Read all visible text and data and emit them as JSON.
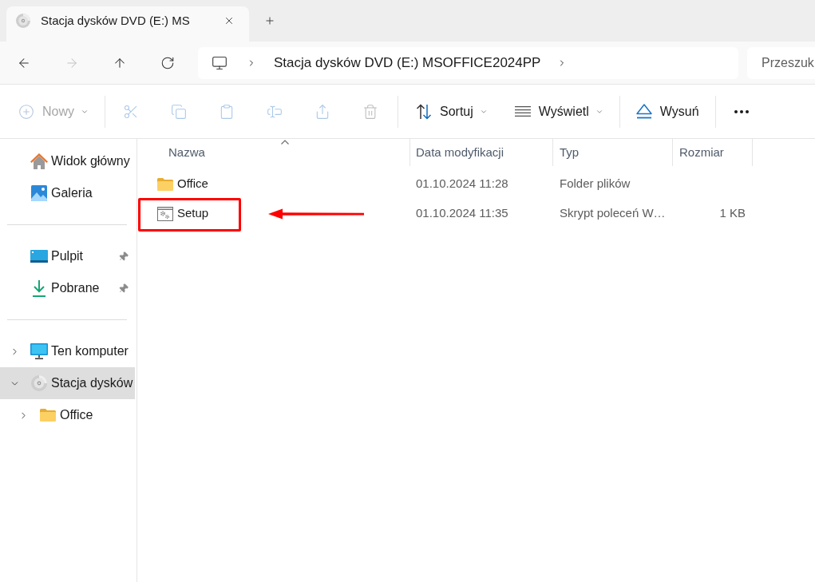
{
  "tabs": [
    {
      "title": "Stacja dysków DVD (E:) MS",
      "selected": true
    }
  ],
  "nav": {
    "buttons": [
      {
        "disabled": false
      },
      {
        "disabled": true
      },
      {
        "disabled": false
      },
      {
        "disabled": false
      }
    ]
  },
  "address": {
    "segments": [
      "Stacja dysków DVD (E:) MSOFFICE2024PP"
    ]
  },
  "search": {
    "placeholder": "Przeszuk"
  },
  "toolbar": {
    "groups": [
      [
        {
          "label": "Nowy",
          "disabled": true,
          "dropdown": true
        }
      ],
      [
        {
          "disabled": true
        },
        {
          "disabled": true
        },
        {
          "disabled": true
        },
        {
          "disabled": true
        },
        {
          "disabled": true
        },
        {
          "disabled": true
        }
      ],
      [
        {
          "label": "Sortuj",
          "disabled": false,
          "dropdown": true
        },
        {
          "label": "Wyświetl",
          "disabled": false,
          "dropdown": true
        }
      ],
      [
        {
          "label": "Wysuń",
          "disabled": false,
          "dropdown": false
        }
      ],
      [
        {
          "disabled": false
        }
      ]
    ]
  },
  "sidebar": {
    "sections": [
      {
        "items": [
          {
            "label": "Widok główny",
            "selected": false,
            "pinned": false
          },
          {
            "label": "Galeria",
            "selected": false,
            "pinned": false
          }
        ]
      },
      {
        "items": [
          {
            "label": "Pulpit",
            "selected": false,
            "pinned": true
          },
          {
            "label": "Pobrane",
            "selected": false,
            "pinned": true
          }
        ]
      },
      {
        "items": [
          {
            "label": "Ten komputer",
            "selected": false,
            "expanded": false
          },
          {
            "label": "Stacja dysków",
            "selected": true,
            "expanded": true,
            "children": [
              {
                "label": "Office",
                "selected": false,
                "expanded": false
              }
            ]
          }
        ]
      }
    ]
  },
  "table": {
    "columns": [
      {
        "label": "Nazwa",
        "sorted": true
      },
      {
        "label": "Data modyfikacji",
        "sorted": false
      },
      {
        "label": "Typ",
        "sorted": false
      },
      {
        "label": "Rozmiar",
        "sorted": false
      }
    ],
    "rows": [
      {
        "kind": "folder",
        "name": "Office",
        "modified": "01.10.2024 11:28",
        "type": "Folder plików",
        "selected": false,
        "callout": false
      },
      {
        "kind": "script",
        "name": "Setup",
        "modified": "01.10.2024 11:35",
        "type": "Skrypt poleceń W…",
        "size": "1 KB",
        "selected": false,
        "callout": true
      }
    ]
  }
}
